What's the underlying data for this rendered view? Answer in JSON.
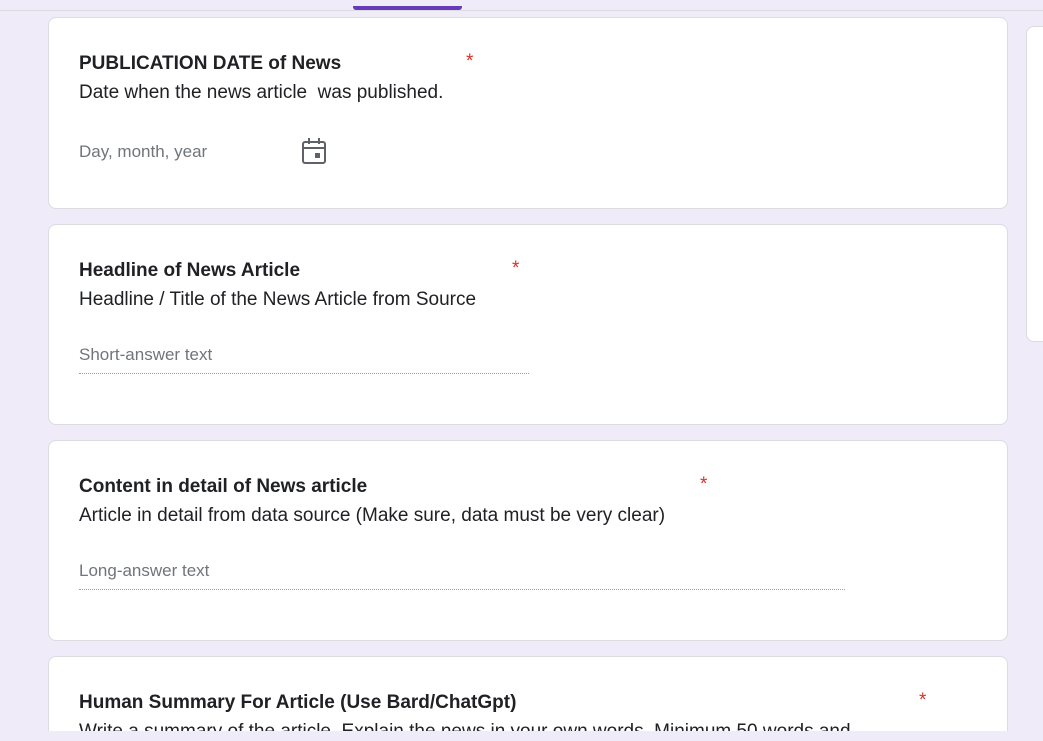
{
  "questions": [
    {
      "title": "PUBLICATION DATE of News",
      "required_marker": "*",
      "description": "Date when the news article  was published.",
      "answer_placeholder": "Day, month, year",
      "answer_icon": "calendar-icon"
    },
    {
      "title": "Headline of News Article",
      "required_marker": "*",
      "description": "Headline / Title of the News Article from Source",
      "answer_placeholder": "Short-answer text"
    },
    {
      "title": "Content in detail of News article",
      "required_marker": "*",
      "description": "Article in detail from data source (Make sure, data must be very clear)",
      "answer_placeholder": "Long-answer text"
    },
    {
      "title": "Human Summary For Article (Use Bard/ChatGpt)",
      "required_marker": "*",
      "description": "Write a summary of the article. Explain the news in your own words. Minimum 50 words and"
    }
  ],
  "colors": {
    "page_background": "#f0ebf8",
    "accent": "#673ab7",
    "required": "#d93025",
    "placeholder": "#70757a"
  }
}
